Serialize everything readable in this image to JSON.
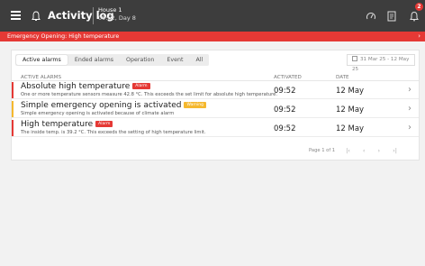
{
  "topbar": {
    "title": "Activity log",
    "house": "House 1",
    "datetime": "09:52, Day 8",
    "notification_count": "2"
  },
  "banner": {
    "text": "Emergency Opening: High temperature",
    "chevron": "›"
  },
  "tabs": [
    {
      "label": "Active alarms",
      "active": true
    },
    {
      "label": "Ended alarms",
      "active": false
    },
    {
      "label": "Operation",
      "active": false
    },
    {
      "label": "Event",
      "active": false
    },
    {
      "label": "All",
      "active": false
    }
  ],
  "date_range": "31 Mar 25 - 12 May 25",
  "table": {
    "headers": {
      "alarm": "ACTIVE ALARMS",
      "activated": "ACTIVATED",
      "date": "DATE"
    },
    "rows": [
      {
        "title": "Absolute high temperature",
        "label": "Alarm",
        "label_color": "#e53935",
        "description": "One or more temperature sensors measure 42.8 °C. This exceeds the set limit for absolute high temperature.",
        "activated": "09:52",
        "date": "12 May"
      },
      {
        "title": "Simple emergency opening is activated",
        "label": "Warning",
        "label_color": "#f5b82e",
        "description": "Simple emergency opening is activated because of climate alarm",
        "activated": "09:52",
        "date": "12 May"
      },
      {
        "title": "High temperature",
        "label": "Alarm",
        "label_color": "#e53935",
        "description": "The inside temp. is 39.2 °C. This exceeds the setting of high temperature limit.",
        "activated": "09:52",
        "date": "12 May"
      }
    ],
    "row_chevron": "›"
  },
  "pager": {
    "text": "Page 1 of 1",
    "first": "|‹",
    "prev": "‹",
    "next": "›",
    "last": "›|"
  },
  "colors": {
    "topbar": "#3d3d3d",
    "banner": "#e53935",
    "alarm": "#e53935",
    "warning": "#f5b82e"
  }
}
